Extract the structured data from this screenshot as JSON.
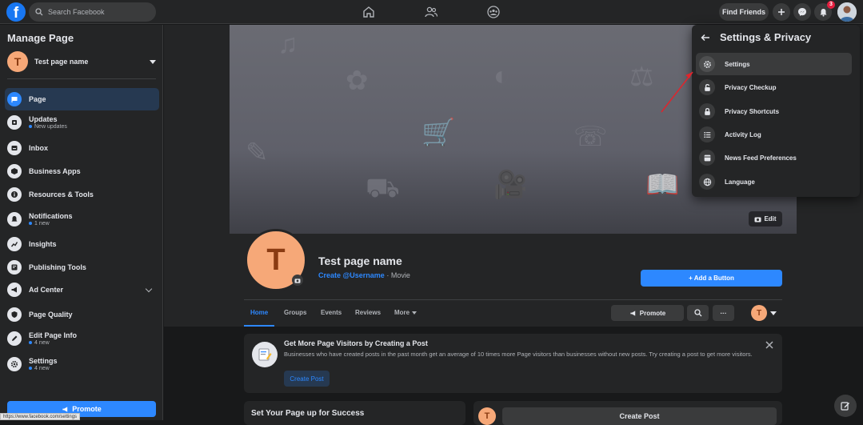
{
  "topbar": {
    "logo": "f",
    "search_placeholder": "Search Facebook",
    "find_friends": "Find Friends",
    "notification_count": "3"
  },
  "sidebar": {
    "title": "Manage Page",
    "page_name": "Test page name",
    "page_initial": "T",
    "items": [
      {
        "label": "Page",
        "sub": ""
      },
      {
        "label": "Updates",
        "sub": "New updates"
      },
      {
        "label": "Inbox",
        "sub": ""
      },
      {
        "label": "Business Apps",
        "sub": ""
      },
      {
        "label": "Resources & Tools",
        "sub": ""
      },
      {
        "label": "Notifications",
        "sub": "1 new"
      },
      {
        "label": "Insights",
        "sub": ""
      },
      {
        "label": "Publishing Tools",
        "sub": ""
      },
      {
        "label": "Ad Center",
        "sub": ""
      },
      {
        "label": "Page Quality",
        "sub": ""
      },
      {
        "label": "Edit Page Info",
        "sub": "4 new"
      },
      {
        "label": "Settings",
        "sub": "4 new"
      }
    ],
    "promote": "Promote",
    "status_url": "https://www.facebook.com/settings"
  },
  "page": {
    "name": "Test page name",
    "initial": "T",
    "username": "Create @Username",
    "category": " · Movie",
    "edit_cover": "Edit",
    "add_button": "+ Add a Button",
    "tabs": [
      "Home",
      "Groups",
      "Events",
      "Reviews",
      "More"
    ],
    "promote": "Promote",
    "more_dots": "···"
  },
  "tip": {
    "title": "Get More Page Visitors by Creating a Post",
    "body": "Businesses who have created posts in the past month get an average of 10 times more Page visitors than businesses without new posts. Try creating a post to get more visitors.",
    "button": "Create Post"
  },
  "success": {
    "title": "Set Your Page up for Success"
  },
  "create_post": {
    "label": "Create Post"
  },
  "dropdown": {
    "title": "Settings & Privacy",
    "items": [
      "Settings",
      "Privacy Checkup",
      "Privacy Shortcuts",
      "Activity Log",
      "News Feed Preferences",
      "Language"
    ]
  },
  "colors": {
    "accent": "#2d88ff",
    "surface": "#242526",
    "background": "#18191a",
    "annotation_arrow": "#e0242c"
  }
}
